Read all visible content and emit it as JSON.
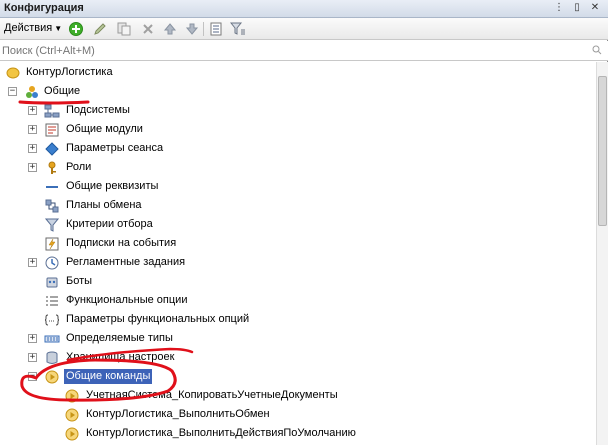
{
  "window": {
    "title": "Конфигурация",
    "controls": [
      "⋮",
      "▯",
      "✕"
    ]
  },
  "toolbar": {
    "actions_label": "Действия",
    "buttons": [
      "add-icon",
      "edit-icon",
      "copy-icon",
      "delete-icon",
      "move-up-icon",
      "move-down-icon",
      "list-icon",
      "filter-icon"
    ]
  },
  "search": {
    "placeholder": "Поиск (Ctrl+Alt+M)",
    "value": ""
  },
  "tree": {
    "root": "КонтурЛогистика",
    "common": "Общие",
    "items": [
      {
        "label": "Подсистемы",
        "icon": "subsystems-icon",
        "expandable": true
      },
      {
        "label": "Общие модули",
        "icon": "common-modules-icon",
        "expandable": true
      },
      {
        "label": "Параметры сеанса",
        "icon": "session-params-icon",
        "expandable": true
      },
      {
        "label": "Роли",
        "icon": "roles-icon",
        "expandable": true
      },
      {
        "label": "Общие реквизиты",
        "icon": "common-attributes-icon",
        "expandable": false
      },
      {
        "label": "Планы обмена",
        "icon": "exchange-plans-icon",
        "expandable": false
      },
      {
        "label": "Критерии отбора",
        "icon": "filter-criteria-icon",
        "expandable": false
      },
      {
        "label": "Подписки на события",
        "icon": "event-subscriptions-icon",
        "expandable": false
      },
      {
        "label": "Регламентные задания",
        "icon": "scheduled-jobs-icon",
        "expandable": true
      },
      {
        "label": "Боты",
        "icon": "bots-icon",
        "expandable": false
      },
      {
        "label": "Функциональные опции",
        "icon": "functional-options-icon",
        "expandable": false
      },
      {
        "label": "Параметры функциональных опций",
        "icon": "functional-options-params-icon",
        "expandable": false
      },
      {
        "label": "Определяемые типы",
        "icon": "defined-types-icon",
        "expandable": true
      },
      {
        "label": "Хранилища настроек",
        "icon": "settings-storages-icon",
        "expandable": true
      },
      {
        "label": "Общие команды",
        "icon": "common-commands-icon",
        "expandable": true,
        "selected": true
      }
    ],
    "commands": [
      "УчетнаяСистема_КопироватьУчетныеДокументы",
      "КонтурЛогистика_ВыполнитьОбмен",
      "КонтурЛогистика_ВыполнитьДействияПоУмолчанию"
    ]
  },
  "colors": {
    "selection": "#3d63b8",
    "annotation": "#e0101a"
  }
}
